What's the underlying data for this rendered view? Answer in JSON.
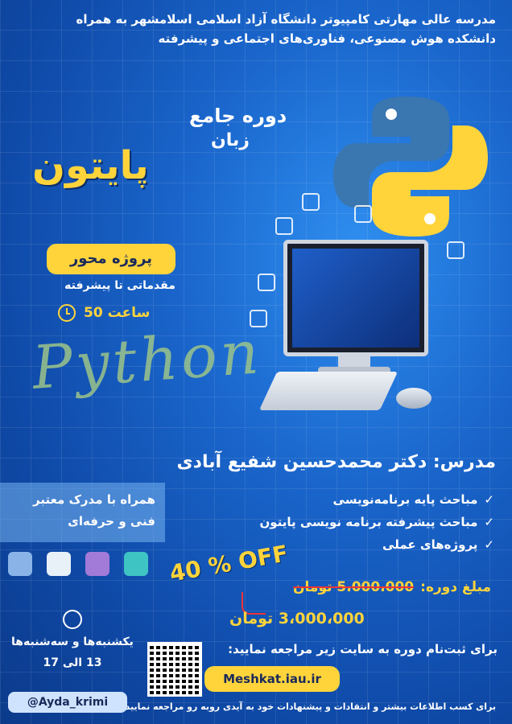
{
  "header": {
    "line1": "مدرسه عالی مهارتی کامپیوتر دانشگاه آزاد اسلامی اسلامشهر به همراه",
    "line2": "دانشکده هوش مصنوعی، فناوری‌های اجتماعی و پیشرفته"
  },
  "title": {
    "line1": "دوره جامع",
    "line2": "زبان",
    "line3": "پایتون"
  },
  "badge": {
    "project": "پروژه محور",
    "level": "مقدماتی تا پیشرفته",
    "hours": "50 ساعت"
  },
  "watermark": "Python",
  "teacher": "مدرس: دکتر محمدحسین شفیع آبادی",
  "certificate": {
    "line1": "همراه با مدرک معتبر",
    "line2": "فنی و حرفه‌ای"
  },
  "topics": [
    "مباحث پایه برنامه‌نویسی",
    "مباحث پیشرفته برنامه نویسی پایتون",
    "پروژه‌های عملی"
  ],
  "discount": "40 % OFF",
  "price": {
    "label": "مبلغ دوره:",
    "old": "5،000،000 تومان",
    "new": "3،000،000 تومان"
  },
  "schedule": {
    "days": "یکشنبه‌ها و سه‌شنبه‌ها",
    "dates": "13 الی 17"
  },
  "register": {
    "text": "برای ثبت‌نام دوره به سایت زیر مراجعه نمایید:",
    "site": "Meshkat.iau.ir"
  },
  "handle": "@Ayda_krimi",
  "footer": "برای کسب اطلاعات بیشتر و انتقادات و پیشنهادات خود به آیدی روبه رو مراجعه نمایید",
  "colors": {
    "accent": "#ffd43b",
    "background": "#1a66cc",
    "python_blue": "#3a76b0"
  },
  "icons": [
    "python-logo-icon",
    "check-icon",
    "clock-icon",
    "qr-code"
  ]
}
